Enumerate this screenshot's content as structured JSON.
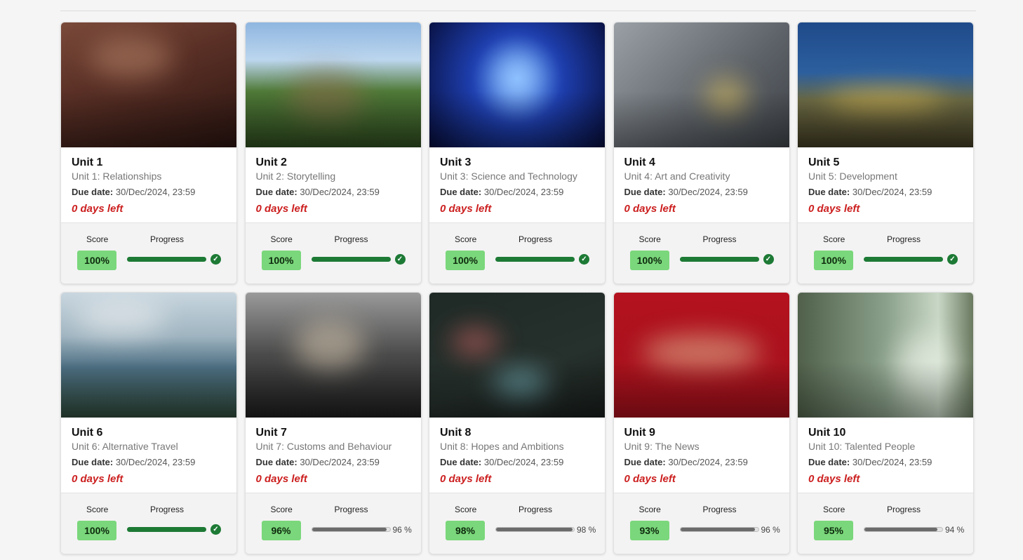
{
  "units": [
    {
      "title": "Unit 1",
      "subtitle": "Unit 1: Relationships",
      "due_label": "Due date:",
      "due_value": "30/Dec/2024, 23:59",
      "days_left": "0 days left",
      "score_label": "Score",
      "progress_label": "Progress",
      "score": "100%",
      "progress": 1.0,
      "progress_text": "",
      "complete": true,
      "image": "desert-camel-image"
    },
    {
      "title": "Unit 2",
      "subtitle": "Unit 2: Storytelling",
      "due_label": "Due date:",
      "due_value": "30/Dec/2024, 23:59",
      "days_left": "0 days left",
      "score_label": "Score",
      "progress_label": "Progress",
      "score": "100%",
      "progress": 1.0,
      "progress_text": "",
      "complete": true,
      "image": "thatched-mill-house-image"
    },
    {
      "title": "Unit 3",
      "subtitle": "Unit 3: Science and Technology",
      "due_label": "Due date:",
      "due_value": "30/Dec/2024, 23:59",
      "days_left": "0 days left",
      "score_label": "Score",
      "progress_label": "Progress",
      "score": "100%",
      "progress": 1.0,
      "progress_text": "",
      "complete": true,
      "image": "blue-light-installation-image"
    },
    {
      "title": "Unit 4",
      "subtitle": "Unit 4: Art and Creativity",
      "due_label": "Due date:",
      "due_value": "30/Dec/2024, 23:59",
      "days_left": "0 days left",
      "score_label": "Score",
      "progress_label": "Progress",
      "score": "100%",
      "progress": 1.0,
      "progress_text": "",
      "complete": true,
      "image": "street-crossing-flowers-image"
    },
    {
      "title": "Unit 5",
      "subtitle": "Unit 5: Development",
      "due_label": "Due date:",
      "due_value": "30/Dec/2024, 23:59",
      "days_left": "0 days left",
      "score_label": "Score",
      "progress_label": "Progress",
      "score": "100%",
      "progress": 1.0,
      "progress_text": "",
      "complete": true,
      "image": "construction-site-night-image"
    },
    {
      "title": "Unit 6",
      "subtitle": "Unit 6: Alternative Travel",
      "due_label": "Due date:",
      "due_value": "30/Dec/2024, 23:59",
      "days_left": "0 days left",
      "score_label": "Score",
      "progress_label": "Progress",
      "score": "100%",
      "progress": 1.0,
      "progress_text": "",
      "complete": true,
      "image": "mountain-cliff-house-image"
    },
    {
      "title": "Unit 7",
      "subtitle": "Unit 7: Customs and Behaviour",
      "due_label": "Due date:",
      "due_value": "30/Dec/2024, 23:59",
      "days_left": "0 days left",
      "score_label": "Score",
      "progress_label": "Progress",
      "score": "96%",
      "progress": 0.96,
      "progress_text": "96 %",
      "complete": false,
      "image": "crowded-train-image"
    },
    {
      "title": "Unit 8",
      "subtitle": "Unit 8: Hopes and Ambitions",
      "due_label": "Due date:",
      "due_value": "30/Dec/2024, 23:59",
      "days_left": "0 days left",
      "score_label": "Score",
      "progress_label": "Progress",
      "score": "98%",
      "progress": 0.98,
      "progress_text": "98 %",
      "complete": false,
      "image": "chalkboard-wall-image"
    },
    {
      "title": "Unit 9",
      "subtitle": "Unit 9: The News",
      "due_label": "Due date:",
      "due_value": "30/Dec/2024, 23:59",
      "days_left": "0 days left",
      "score_label": "Score",
      "progress_label": "Progress",
      "score": "93%",
      "progress": 0.96,
      "progress_text": "96 %",
      "complete": false,
      "image": "red-floor-sleepers-image"
    },
    {
      "title": "Unit 10",
      "subtitle": "Unit 10: Talented People",
      "due_label": "Due date:",
      "due_value": "30/Dec/2024, 23:59",
      "days_left": "0 days left",
      "score_label": "Score",
      "progress_label": "Progress",
      "score": "95%",
      "progress": 0.94,
      "progress_text": "94 %",
      "complete": false,
      "image": "forest-elephant-image"
    }
  ],
  "colors": {
    "score_badge": "#7ad77b",
    "progress_complete": "#1d7a35",
    "progress_partial": "#6b6b6b",
    "days_left": "#cc1f1f"
  },
  "icons": {
    "complete": "check-circle-icon"
  }
}
